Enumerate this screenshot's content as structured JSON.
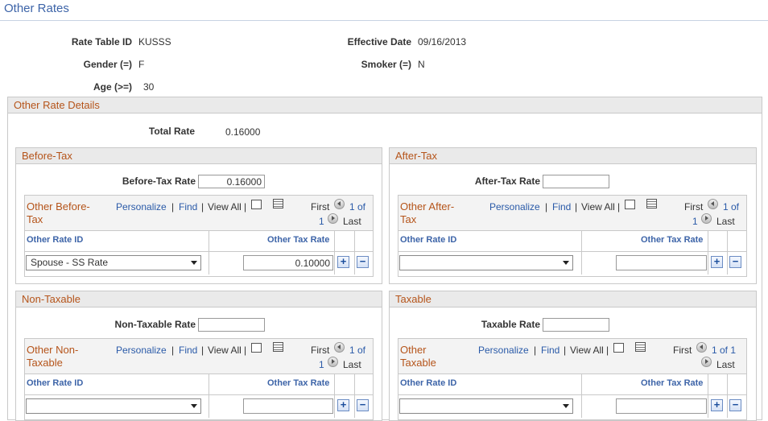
{
  "page": {
    "title": "Other Rates"
  },
  "header": {
    "rate_table_id_label": "Rate Table ID",
    "rate_table_id": "KUSSS",
    "effective_date_label": "Effective Date",
    "effective_date": "09/16/2013",
    "gender_label": "Gender (=)",
    "gender": "F",
    "smoker_label": "Smoker (=)",
    "smoker": "N",
    "age_label": "Age (>=)",
    "age": "30"
  },
  "details": {
    "title": "Other Rate Details",
    "total_rate_label": "Total Rate",
    "total_rate": "0.16000"
  },
  "nav": {
    "personalize": "Personalize",
    "find": "Find",
    "sep": "|",
    "view_all": "View All",
    "first": "First",
    "last": "Last",
    "one_of": "1 of",
    "one": "1",
    "one_of_one": "1 of 1"
  },
  "cols": {
    "other_rate_id": "Other Rate ID",
    "other_tax_rate": "Other Tax Rate"
  },
  "buttons": {
    "add": "+",
    "remove": "−"
  },
  "before_tax": {
    "title": "Before-Tax",
    "rate_label": "Before-Tax Rate",
    "rate": "0.16000",
    "grid_title_1": "Other Before-",
    "grid_title_2": "Tax",
    "row": {
      "other_rate_id": "Spouse - SS Rate",
      "other_tax_rate": "0.10000"
    }
  },
  "after_tax": {
    "title": "After-Tax",
    "rate_label": "After-Tax Rate",
    "rate": "",
    "grid_title_1": "Other After-",
    "grid_title_2": "Tax",
    "row": {
      "other_rate_id": "",
      "other_tax_rate": ""
    }
  },
  "non_taxable": {
    "title": "Non-Taxable",
    "rate_label": "Non-Taxable Rate",
    "rate": "",
    "grid_title_1": "Other Non-",
    "grid_title_2": "Taxable",
    "row": {
      "other_rate_id": "",
      "other_tax_rate": ""
    }
  },
  "taxable": {
    "title": "Taxable",
    "rate_label": "Taxable Rate",
    "rate": "",
    "grid_title_1": "Other",
    "grid_title_2": "Taxable",
    "row": {
      "other_rate_id": "",
      "other_tax_rate": ""
    }
  }
}
